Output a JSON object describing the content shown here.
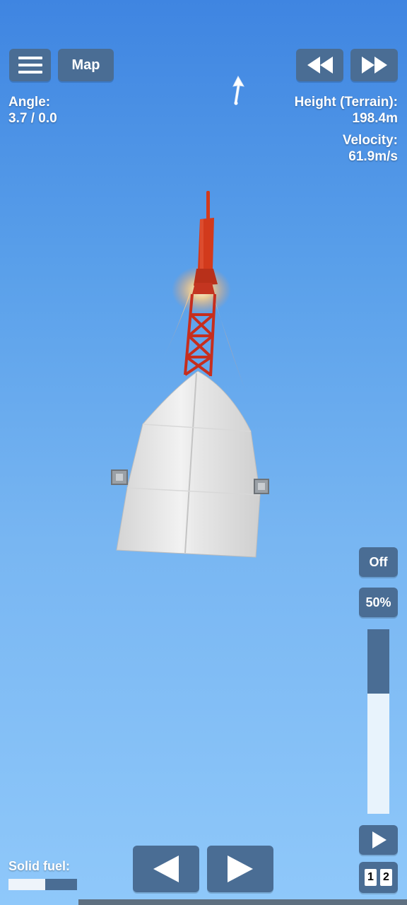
{
  "hud": {
    "map_label": "Map",
    "angle_label": "Angle:",
    "angle_value": "3.7 / 0.0",
    "height_label": "Height (Terrain):",
    "height_value": "198.4m",
    "velocity_label": "Velocity:",
    "velocity_value": "61.9m/s"
  },
  "controls": {
    "toggle_label": "Off",
    "throttle_label": "50%",
    "throttle_level": 0.5,
    "solid_fuel_label": "Solid fuel:",
    "solid_fuel_level": 0.54,
    "stage_buttons": [
      "1",
      "2"
    ]
  },
  "icons": {
    "menu": "hamburger-icon",
    "rewind": "rewind-icon",
    "fast_forward": "fast-forward-icon",
    "direction": "up-arrow-icon",
    "stage": "play-icon",
    "rotate_left": "left-arrow-icon",
    "rotate_right": "right-arrow-icon"
  },
  "colors": {
    "button": "#4a6d94",
    "rocket_red": "#d23a1c",
    "fairing": "#e6e6e6",
    "sky_top": "#3f85e1",
    "sky_bottom": "#8fc8fa"
  }
}
